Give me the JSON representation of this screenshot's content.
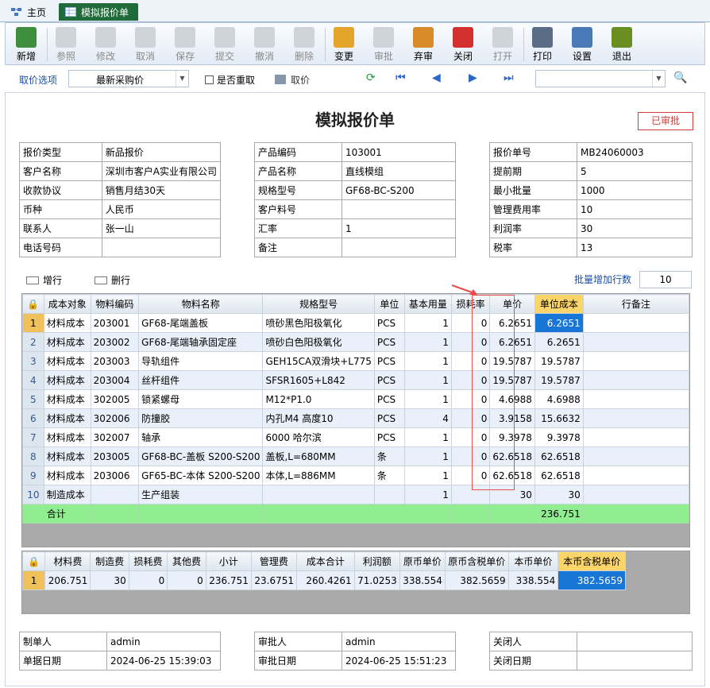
{
  "tabs": {
    "home": "主页",
    "active": "模拟报价单"
  },
  "toolbar": [
    {
      "label": "新增",
      "icon": "add-icon",
      "enabled": true,
      "color": "#3e8e3e"
    },
    {
      "label": "参照",
      "icon": "reference-icon",
      "enabled": false
    },
    {
      "label": "修改",
      "icon": "edit-icon",
      "enabled": false
    },
    {
      "label": "取消",
      "icon": "cancel-icon",
      "enabled": false
    },
    {
      "label": "保存",
      "icon": "save-icon",
      "enabled": false
    },
    {
      "label": "提交",
      "icon": "submit-icon",
      "enabled": false
    },
    {
      "label": "撤消",
      "icon": "undo-icon",
      "enabled": false
    },
    {
      "label": "删除",
      "icon": "delete-icon",
      "enabled": false
    },
    {
      "label": "变更",
      "icon": "change-icon",
      "enabled": true,
      "color": "#e5a52b"
    },
    {
      "label": "审批",
      "icon": "approve-icon",
      "enabled": false
    },
    {
      "label": "弃审",
      "icon": "unapprove-icon",
      "enabled": true,
      "color": "#d98b2a"
    },
    {
      "label": "关闭",
      "icon": "close-doc-icon",
      "enabled": true,
      "color": "#d43030"
    },
    {
      "label": "打开",
      "icon": "open-icon",
      "enabled": false
    },
    {
      "label": "打印",
      "icon": "print-icon",
      "enabled": true,
      "color": "#5a6d86"
    },
    {
      "label": "设置",
      "icon": "settings-icon",
      "enabled": true,
      "color": "#4a79b8"
    },
    {
      "label": "退出",
      "icon": "exit-icon",
      "enabled": true,
      "color": "#6b8e23"
    }
  ],
  "options": {
    "label": "取价选项",
    "selected": "最新采购价",
    "recheck": "是否重取",
    "fetch": "取价",
    "search_value": ""
  },
  "form": {
    "title": "模拟报价单",
    "status": "已审批",
    "left": [
      {
        "k": "报价类型",
        "v": "新品报价"
      },
      {
        "k": "客户名称",
        "v": "深圳市客户A实业有限公司"
      },
      {
        "k": "收款协议",
        "v": "销售月结30天"
      },
      {
        "k": "币种",
        "v": "人民币"
      },
      {
        "k": "联系人",
        "v": "张一山"
      },
      {
        "k": "电话号码",
        "v": ""
      }
    ],
    "mid": [
      {
        "k": "产品编码",
        "v": "103001"
      },
      {
        "k": "产品名称",
        "v": "直线模组"
      },
      {
        "k": "规格型号",
        "v": "GF68-BC-S200"
      },
      {
        "k": "客户料号",
        "v": ""
      },
      {
        "k": "汇率",
        "v": "1"
      },
      {
        "k": "备注",
        "v": ""
      }
    ],
    "right": [
      {
        "k": "报价单号",
        "v": "MB24060003"
      },
      {
        "k": "提前期",
        "v": "5"
      },
      {
        "k": "最小批量",
        "v": "1000"
      },
      {
        "k": "管理费用率",
        "v": "10"
      },
      {
        "k": "利润率",
        "v": "30"
      },
      {
        "k": "税率",
        "v": "13"
      }
    ]
  },
  "gridtools": {
    "add": "增行",
    "del": "删行",
    "batch": "批量增加行数",
    "batch_value": "10"
  },
  "grid1": {
    "headers": [
      "成本对象",
      "物料编码",
      "物料名称",
      "规格型号",
      "单位",
      "基本用量",
      "损耗率",
      "单价",
      "单位成本",
      "行备注"
    ],
    "rows": [
      [
        "1",
        "材料成本",
        "203001",
        "GF68-尾端盖板",
        "喷砂黑色阳极氧化",
        "PCS",
        "1",
        "0",
        "6.2651",
        "6.2651",
        ""
      ],
      [
        "2",
        "材料成本",
        "203002",
        "GF68-尾端轴承固定座",
        "喷砂白色阳极氧化",
        "PCS",
        "1",
        "0",
        "6.2651",
        "6.2651",
        ""
      ],
      [
        "3",
        "材料成本",
        "203003",
        "导轨组件",
        "GEH15CA双滑块+L775",
        "PCS",
        "1",
        "0",
        "19.5787",
        "19.5787",
        ""
      ],
      [
        "4",
        "材料成本",
        "203004",
        "丝杆组件",
        "SFSR1605+L842",
        "PCS",
        "1",
        "0",
        "19.5787",
        "19.5787",
        ""
      ],
      [
        "5",
        "材料成本",
        "302005",
        "锁紧螺母",
        "M12*P1.0",
        "PCS",
        "1",
        "0",
        "4.6988",
        "4.6988",
        ""
      ],
      [
        "6",
        "材料成本",
        "302006",
        "防撞胶",
        "内孔M4 高度10",
        "PCS",
        "4",
        "0",
        "3.9158",
        "15.6632",
        ""
      ],
      [
        "7",
        "材料成本",
        "302007",
        "轴承",
        "6000 哈尔滨",
        "PCS",
        "1",
        "0",
        "9.3978",
        "9.3978",
        ""
      ],
      [
        "8",
        "材料成本",
        "203005",
        "GF68-BC-盖板 S200-S200",
        "盖板,L=680MM",
        "条",
        "1",
        "0",
        "62.6518",
        "62.6518",
        ""
      ],
      [
        "9",
        "材料成本",
        "203006",
        "GF65-BC-本体 S200-S200",
        "本体,L=886MM",
        "条",
        "1",
        "0",
        "62.6518",
        "62.6518",
        ""
      ],
      [
        "10",
        "制造成本",
        "",
        "生产组装",
        "",
        "",
        "1",
        "",
        "30",
        "30",
        ""
      ]
    ],
    "sum": {
      "label": "合计",
      "total": "236.751"
    }
  },
  "grid2": {
    "headers": [
      "材料费",
      "制造费",
      "损耗费",
      "其他费",
      "小计",
      "管理费",
      "成本合计",
      "利润额",
      "原币单价",
      "原币含税单价",
      "本币单价",
      "本币含税单价"
    ],
    "row": [
      "1",
      "206.751",
      "30",
      "0",
      "0",
      "236.751",
      "23.6751",
      "260.4261",
      "71.0253",
      "338.554",
      "382.5659",
      "338.554",
      "382.5659"
    ]
  },
  "footer": {
    "left": [
      {
        "k": "制单人",
        "v": "admin"
      },
      {
        "k": "单据日期",
        "v": "2024-06-25 15:39:03"
      }
    ],
    "mid": [
      {
        "k": "审批人",
        "v": "admin"
      },
      {
        "k": "审批日期",
        "v": "2024-06-25 15:51:23"
      }
    ],
    "right": [
      {
        "k": "关闭人",
        "v": ""
      },
      {
        "k": "关闭日期",
        "v": ""
      }
    ]
  }
}
